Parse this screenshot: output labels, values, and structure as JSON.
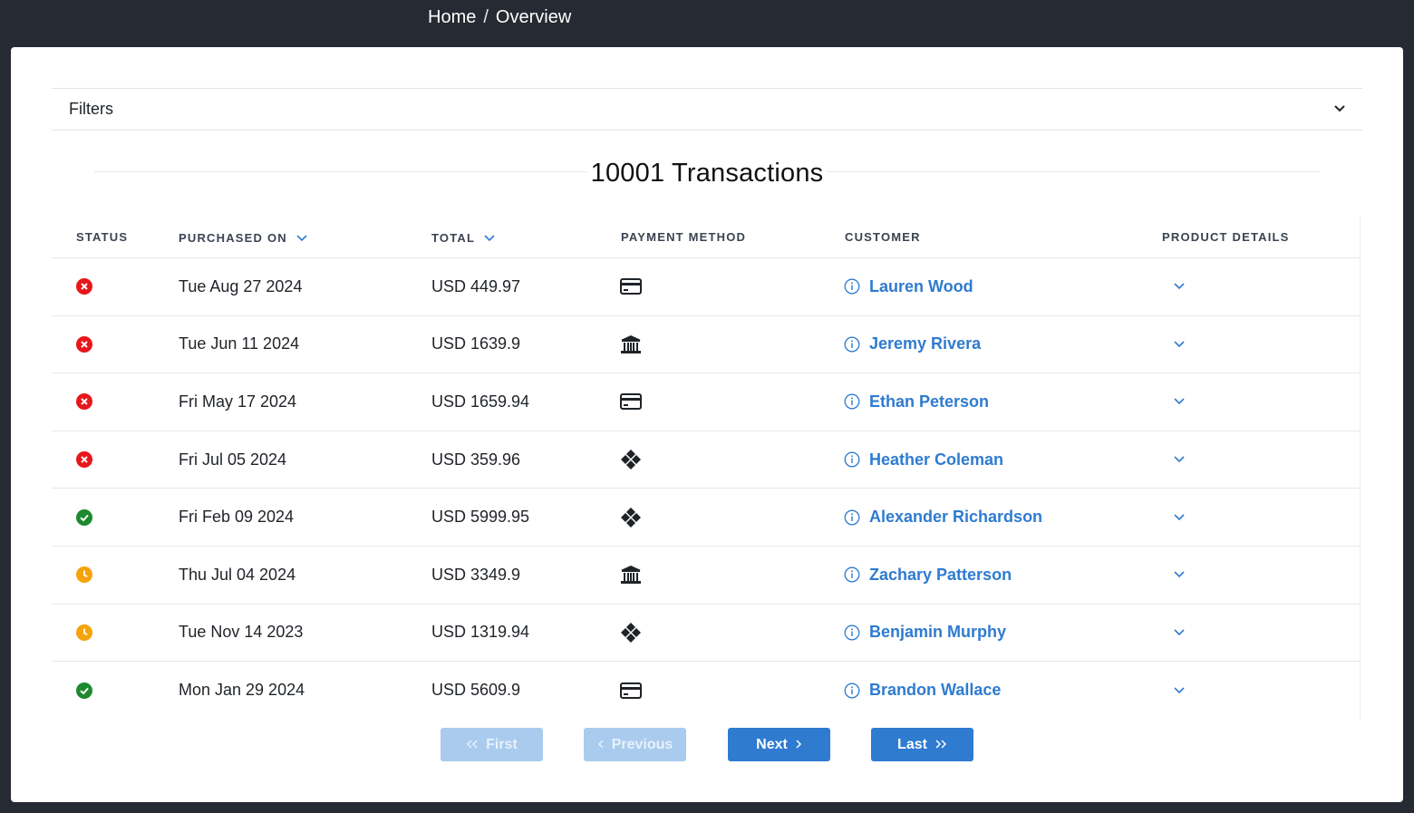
{
  "breadcrumb": {
    "home": "Home",
    "separator": "/",
    "current": "Overview"
  },
  "filters": {
    "label": "Filters",
    "icon": "chevron-down-icon"
  },
  "title": "10001 Transactions",
  "table": {
    "headers": {
      "status": "STATUS",
      "purchased_on": "PURCHASED ON",
      "total": "TOTAL",
      "payment_method": "PAYMENT METHOD",
      "customer": "CUSTOMER",
      "product_details": "PRODUCT DETAILS"
    },
    "rows": [
      {
        "status": "failed",
        "date": "Tue Aug 27 2024",
        "total": "USD 449.97",
        "payment": "card",
        "customer": "Lauren Wood"
      },
      {
        "status": "failed",
        "date": "Tue Jun 11 2024",
        "total": "USD 1639.9",
        "payment": "bank",
        "customer": "Jeremy Rivera"
      },
      {
        "status": "failed",
        "date": "Fri May 17 2024",
        "total": "USD 1659.94",
        "payment": "card",
        "customer": "Ethan Peterson"
      },
      {
        "status": "failed",
        "date": "Fri Jul 05 2024",
        "total": "USD 359.96",
        "payment": "pix",
        "customer": "Heather Coleman"
      },
      {
        "status": "success",
        "date": "Fri Feb 09 2024",
        "total": "USD 5999.95",
        "payment": "pix",
        "customer": "Alexander Richardson"
      },
      {
        "status": "pending",
        "date": "Thu Jul 04 2024",
        "total": "USD 3349.9",
        "payment": "bank",
        "customer": "Zachary Patterson"
      },
      {
        "status": "pending",
        "date": "Tue Nov 14 2023",
        "total": "USD 1319.94",
        "payment": "pix",
        "customer": "Benjamin Murphy"
      },
      {
        "status": "success",
        "date": "Mon Jan 29 2024",
        "total": "USD 5609.9",
        "payment": "card",
        "customer": "Brandon Wallace"
      }
    ]
  },
  "pagination": {
    "first": "First",
    "previous": "Previous",
    "next": "Next",
    "last": "Last"
  },
  "colors": {
    "failed": "#e8161b",
    "success": "#1e8a2e",
    "pending": "#f5a30a",
    "link": "#2e7bd0"
  }
}
